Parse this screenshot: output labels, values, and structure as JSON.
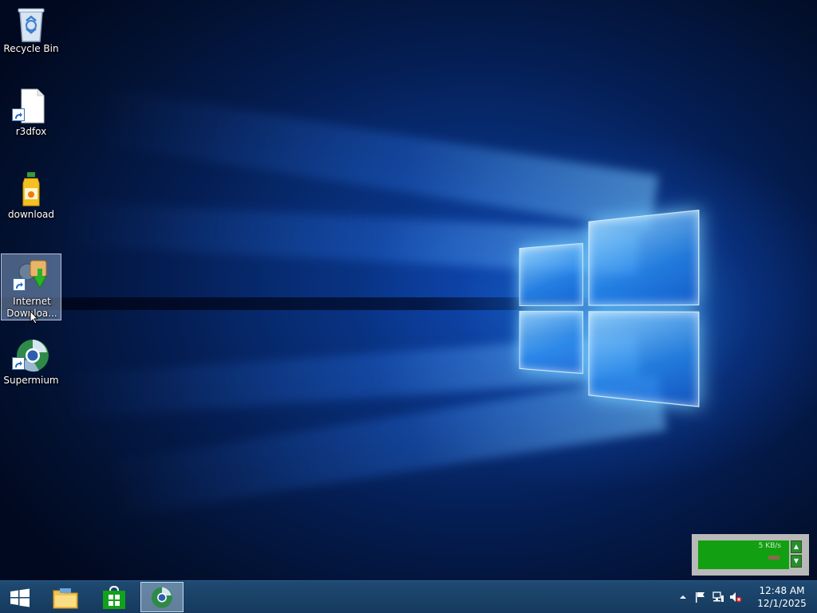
{
  "desktop": {
    "icons": [
      {
        "label": "Recycle Bin",
        "icon": "recycle-bin-icon"
      },
      {
        "label": "r3dfox",
        "icon": "blank-file-shortcut-icon"
      },
      {
        "label": "download",
        "icon": "juice-bottle-icon"
      },
      {
        "label": "Internet\nDownloa...",
        "label_line1": "Internet",
        "label_line2": "Downloa...",
        "icon": "internet-download-manager-icon",
        "selected": true
      },
      {
        "label": "Supermium",
        "icon": "supermium-browser-icon"
      }
    ]
  },
  "network_widget": {
    "rate": "5 KB/s",
    "graph_color": "#12a012"
  },
  "taskbar": {
    "items": [
      {
        "name": "start",
        "icon": "windows-start-icon"
      },
      {
        "name": "file-explorer",
        "icon": "folder-icon"
      },
      {
        "name": "store",
        "icon": "store-bag-icon"
      },
      {
        "name": "supermium",
        "icon": "supermium-browser-icon",
        "active": true
      }
    ],
    "tray": {
      "icons": [
        "chevron-up-icon",
        "flag-icon",
        "network-icon",
        "speaker-muted-icon"
      ],
      "time": "12:48 AM",
      "date": "12/1/2025"
    }
  },
  "colors": {
    "taskbar": "#1c4469",
    "desktop_background": "#041b4d",
    "accent_light": "#6cc6ff"
  }
}
